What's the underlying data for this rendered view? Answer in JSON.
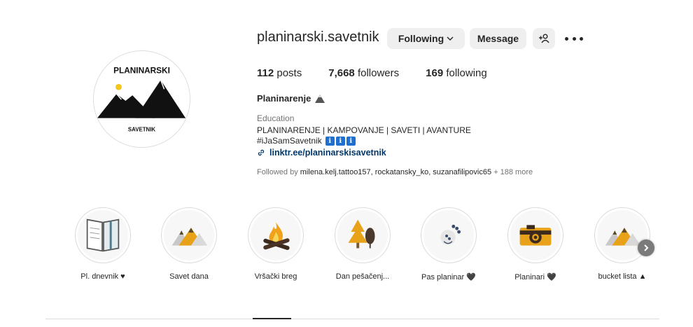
{
  "profile": {
    "username": "planinarski.savetnik",
    "avatar_top_text": "PLANINARSKI",
    "avatar_bottom_text": "SAVETNIK",
    "following_label": "Following",
    "message_label": "Message",
    "stats": {
      "posts_count": "112",
      "posts_label": "posts",
      "followers_count": "7,668",
      "followers_label": "followers",
      "following_count": "169",
      "following_label": "following"
    },
    "full_name": "Planinarenje",
    "category": "Education",
    "bio_line1": "PLANINARENJE | KAMPOVANJE | SAVETI | AVANTURE",
    "bio_line2": "#iJaSamSavetnik",
    "bio_badges": [
      "ℹ",
      "ℹ",
      "ℹ"
    ],
    "link": "linktr.ee/planinarskisavetnik",
    "followed_by_prefix": "Followed by ",
    "followed_by_names": "milena.kelj.tattoo157, rockatansky_ko, suzanafilipovic65",
    "followed_by_more": " + 188 more"
  },
  "highlights": [
    {
      "label": "Pl. dnevnik ♥",
      "icon": "notebook-icon"
    },
    {
      "label": "Savet dana",
      "icon": "mountains-icon"
    },
    {
      "label": "Vršački breg",
      "icon": "campfire-icon"
    },
    {
      "label": "Dan pešačenj...",
      "icon": "trees-icon"
    },
    {
      "label": "Pas planinar 🖤",
      "icon": "paw-icon"
    },
    {
      "label": "Planinari 🖤",
      "icon": "camera-icon"
    },
    {
      "label": "bucket lista ▲",
      "icon": "mountains-icon"
    }
  ],
  "colors": {
    "button_bg": "#efefef",
    "link": "#00376b",
    "secondary_text": "#737373",
    "mountain_orange": "#e8a21a"
  }
}
